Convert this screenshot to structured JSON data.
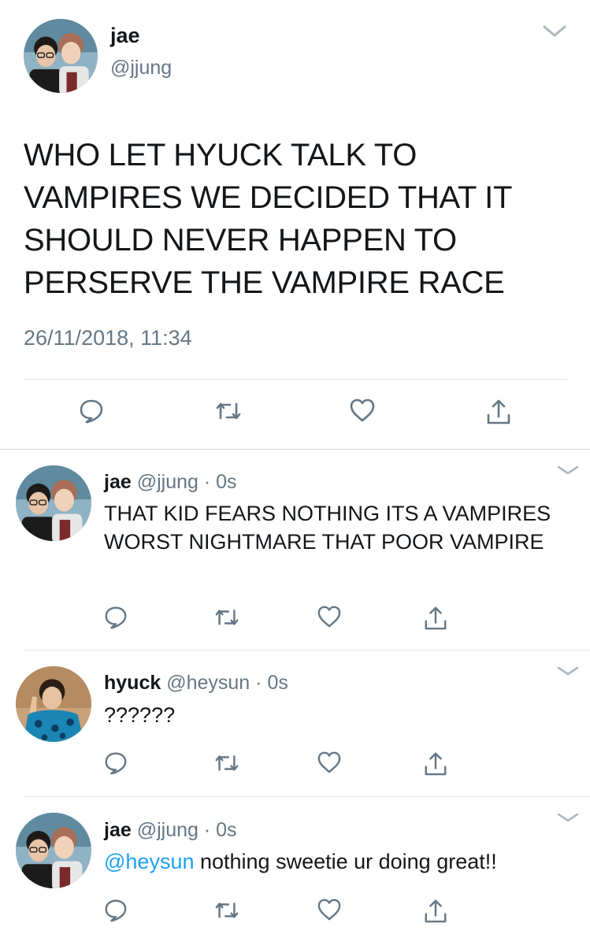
{
  "main_tweet": {
    "display_name": "jae",
    "handle": "@jjung",
    "text": "WHO LET HYUCK TALK TO VAMPIRES WE DECIDED THAT IT SHOULD NEVER HAPPEN TO PERSERVE THE VAMPIRE RACE",
    "timestamp": "26/11/2018, 11:34",
    "avatar": "avatar-photo",
    "menu_icon": "chevron-down-icon",
    "actions": [
      "reply-icon",
      "retweet-icon",
      "like-icon",
      "share-icon"
    ]
  },
  "replies": [
    {
      "display_name": "jae",
      "handle": "@jjung",
      "separator": " · ",
      "age": "0s",
      "mention": "",
      "text": "THAT KID FEARS NOTHING ITS A VAMPIRES WORST NIGHTMARE THAT POOR VAMPIRE",
      "avatar": "avatar-photo"
    },
    {
      "display_name": "hyuck",
      "handle": "@heysun",
      "separator": " · ",
      "age": "0s",
      "mention": "",
      "text": "??????",
      "avatar": "avatar-photo"
    },
    {
      "display_name": "jae",
      "handle": "@jjung",
      "separator": " · ",
      "age": "0s",
      "mention": "@heysun",
      "text": " nothing sweetie ur doing great!!",
      "avatar": "avatar-photo"
    }
  ],
  "colors": {
    "text": "#14171a",
    "secondary": "#657786",
    "link": "#1da1f2",
    "divider": "#e1e8ed"
  }
}
